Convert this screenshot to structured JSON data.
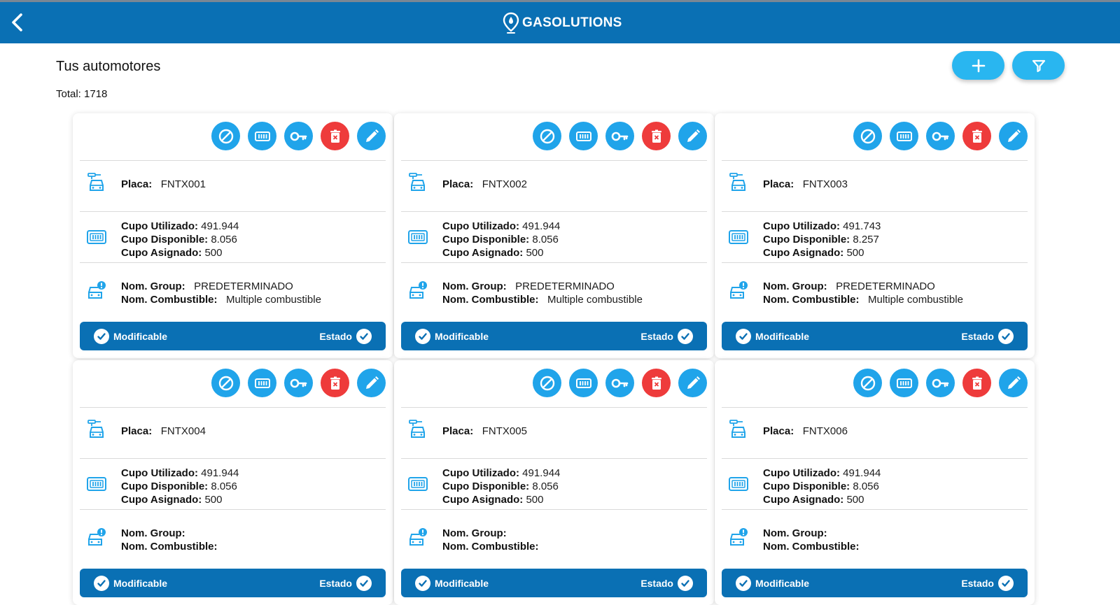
{
  "header": {
    "logo_text": "GASOLUTIONS"
  },
  "page": {
    "title": "Tus automotores",
    "total": "Total: 1718"
  },
  "icons": {
    "back": "chevron-left-icon",
    "add": "plus-icon",
    "filter": "filter-icon",
    "disable": "block-icon",
    "meter": "counter-icon",
    "key": "key-icon",
    "delete": "trash-icon",
    "edit": "pencil-icon"
  },
  "colors": {
    "primary": "#0a70b4",
    "accent": "#20a4ea",
    "danger": "#ee3b3b"
  },
  "labels": {
    "placa": "Placa:",
    "cupo_utilizado": "Cupo Utilizado:",
    "cupo_disponible": "Cupo Disponible:",
    "cupo_asignado": "Cupo Asignado:",
    "nom_group": "Nom. Group:",
    "nom_combustible": "Nom. Combustible:",
    "modificable": "Modificable",
    "estado": "Estado"
  },
  "vehicles": [
    {
      "placa": "FNTX001",
      "utilizado": "491.944",
      "disponible": "8.056",
      "asignado": "500",
      "group": "PREDETERMINADO",
      "combustible": "Multiple combustible"
    },
    {
      "placa": "FNTX002",
      "utilizado": "491.944",
      "disponible": "8.056",
      "asignado": "500",
      "group": "PREDETERMINADO",
      "combustible": "Multiple combustible"
    },
    {
      "placa": "FNTX003",
      "utilizado": "491.743",
      "disponible": "8.257",
      "asignado": "500",
      "group": "PREDETERMINADO",
      "combustible": "Multiple combustible"
    },
    {
      "placa": "FNTX004",
      "utilizado": "491.944",
      "disponible": "8.056",
      "asignado": "500",
      "group": "",
      "combustible": ""
    },
    {
      "placa": "FNTX005",
      "utilizado": "491.944",
      "disponible": "8.056",
      "asignado": "500",
      "group": "",
      "combustible": ""
    },
    {
      "placa": "FNTX006",
      "utilizado": "491.944",
      "disponible": "8.056",
      "asignado": "500",
      "group": "",
      "combustible": ""
    }
  ]
}
